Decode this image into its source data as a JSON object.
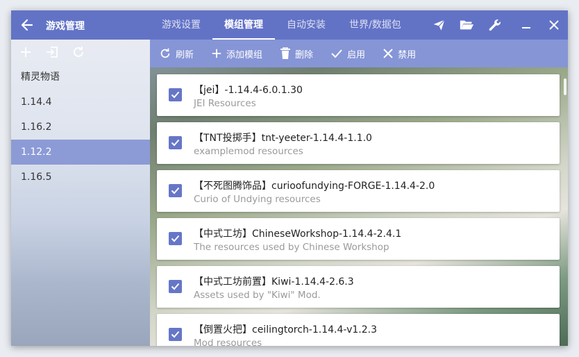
{
  "app": {
    "title": "游戏管理"
  },
  "tabs": [
    {
      "label": "游戏设置",
      "active": false
    },
    {
      "label": "模组管理",
      "active": true
    },
    {
      "label": "自动安装",
      "active": false
    },
    {
      "label": "世界/数据包",
      "active": false
    }
  ],
  "window_icons": [
    "paper-plane-icon",
    "folder-icon",
    "wrench-icon",
    "minimize-icon",
    "close-icon"
  ],
  "sidebar": {
    "tools": [
      "add-icon",
      "import-icon",
      "refresh-icon"
    ],
    "items": [
      {
        "label": "精灵物语",
        "active": false
      },
      {
        "label": "1.14.4",
        "active": false
      },
      {
        "label": "1.16.2",
        "active": false
      },
      {
        "label": "1.12.2",
        "active": true
      },
      {
        "label": "1.16.5",
        "active": false
      }
    ]
  },
  "toolbar": {
    "refresh": "刷新",
    "add_mod": "添加模组",
    "delete": "删除",
    "enable": "启用",
    "disable": "禁用"
  },
  "mods": [
    {
      "title": "【jei】-1.14.4-6.0.1.30",
      "desc": "JEI Resources",
      "checked": true
    },
    {
      "title": "【TNT投掷手】tnt-yeeter-1.14.4-1.1.0",
      "desc": "examplemod resources",
      "checked": true
    },
    {
      "title": "【不死图腾饰品】curioofundying-FORGE-1.14.4-2.0",
      "desc": "Curio of Undying resources",
      "checked": true
    },
    {
      "title": "【中式工坊】ChineseWorkshop-1.14.4-2.4.1",
      "desc": "The resources used by Chinese Workshop",
      "checked": true
    },
    {
      "title": "【中式工坊前置】Kiwi-1.14.4-2.6.3",
      "desc": "Assets used by \"Kiwi\" Mod.",
      "checked": true
    },
    {
      "title": "【倒置火把】ceilingtorch-1.14.4-v1.2.3",
      "desc": "Mod resources",
      "checked": true
    }
  ],
  "colors": {
    "accent": "#6273c6",
    "toolbar": "#8695d6",
    "selected": "#8c9bd6"
  }
}
